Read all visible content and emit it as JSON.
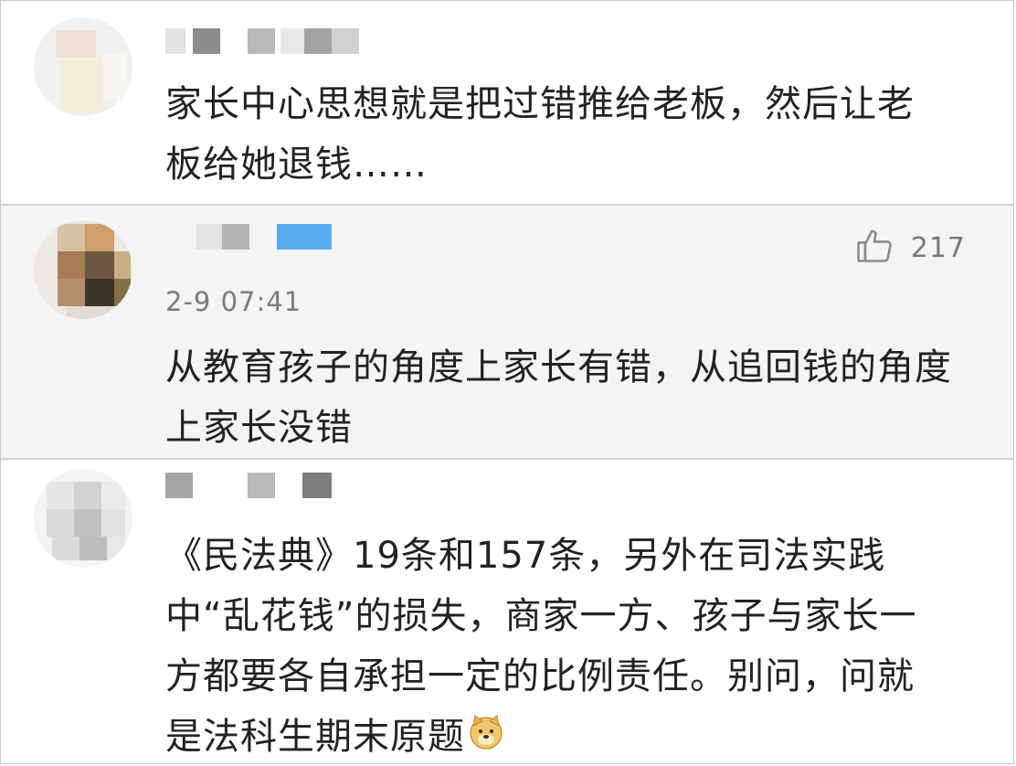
{
  "comments": [
    {
      "text": "家长中心思想就是把过错推给老板，然后让老\n板给她退钱……"
    },
    {
      "timestamp": "2-9 07:41",
      "likes": "217",
      "text": "从教育孩子的角度上家长有错，从追回钱的角度\n上家长没错"
    },
    {
      "text": "《民法典》19条和157条，另外在司法实践\n中“乱花钱”的损失，商家一方、孩子与家长一\n方都要各自承担一定的比例责任。别问，问就\n是法科生期末原题"
    }
  ],
  "icons": {
    "like": "thumbs-up-icon",
    "emoji": "doge-emoji-icon"
  },
  "colors": {
    "text": "#222222",
    "meta": "#7a7a7a",
    "badge": "#5aaaf0"
  }
}
